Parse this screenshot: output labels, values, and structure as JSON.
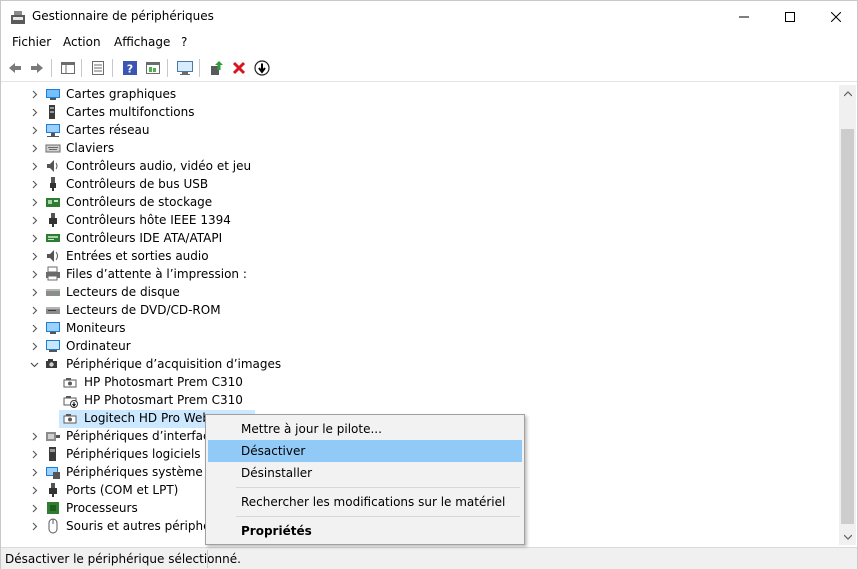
{
  "window": {
    "title": "Gestionnaire de périphériques",
    "minimize_icon": "minimize-icon",
    "maximize_icon": "maximize-icon",
    "close_icon": "close-icon"
  },
  "menu": [
    "Fichier",
    "Action",
    "Affichage",
    "?"
  ],
  "toolbar": [
    "back-arrow-icon",
    "forward-arrow-icon",
    "properties-icon",
    "properties-sheet-icon",
    "help-icon",
    "update-driver-icon",
    "scan-hardware-icon",
    "add-driver-icon",
    "uninstall-icon",
    "disable-icon"
  ],
  "tree": {
    "items": [
      {
        "label": "Cartes graphiques",
        "icon": "display-adapter-icon"
      },
      {
        "label": "Cartes multifonctions",
        "icon": "multifunction-icon"
      },
      {
        "label": "Cartes réseau",
        "icon": "network-adapter-icon"
      },
      {
        "label": "Claviers",
        "icon": "keyboard-icon"
      },
      {
        "label": "Contrôleurs audio, vidéo et jeu",
        "icon": "audio-icon"
      },
      {
        "label": "Contrôleurs de bus USB",
        "icon": "usb-icon"
      },
      {
        "label": "Contrôleurs de stockage",
        "icon": "storage-controller-icon"
      },
      {
        "label": "Contrôleurs hôte IEEE 1394",
        "icon": "ieee1394-icon"
      },
      {
        "label": "Contrôleurs IDE ATA/ATAPI",
        "icon": "ide-icon"
      },
      {
        "label": "Entrées et sorties audio",
        "icon": "audio-io-icon"
      },
      {
        "label": "Files d’attente à l’impression :",
        "icon": "print-queue-icon"
      },
      {
        "label": "Lecteurs de disque",
        "icon": "disk-drive-icon"
      },
      {
        "label": "Lecteurs de DVD/CD-ROM",
        "icon": "dvd-icon"
      },
      {
        "label": "Moniteurs",
        "icon": "monitor-icon"
      },
      {
        "label": "Ordinateur",
        "icon": "computer-icon"
      },
      {
        "label": "Périphérique d’acquisition d’images",
        "icon": "imaging-device-icon",
        "expanded": true
      },
      {
        "label": "HP Photosmart Prem C310",
        "icon": "camera-icon",
        "child": true
      },
      {
        "label": "HP Photosmart Prem C310",
        "icon": "camera-disabled-icon",
        "child": true
      },
      {
        "label": "Logitech HD Pro Webc",
        "icon": "webcam-icon",
        "child": true,
        "selected": true
      },
      {
        "label": "Périphériques d’interface u",
        "icon": "hid-icon"
      },
      {
        "label": "Périphériques logiciels",
        "icon": "software-device-icon"
      },
      {
        "label": "Périphériques système",
        "icon": "system-device-icon"
      },
      {
        "label": "Ports (COM et LPT)",
        "icon": "port-icon"
      },
      {
        "label": "Processeurs",
        "icon": "processor-icon"
      },
      {
        "label": "Souris et autres périphériqu",
        "icon": "mouse-icon"
      }
    ]
  },
  "context_menu": {
    "update": "Mettre à jour le pilote...",
    "disable": "Désactiver",
    "uninstall": "Désinstaller",
    "scan": "Rechercher les modifications sur le matériel",
    "properties": "Propriétés"
  },
  "status": "Désactiver le périphérique sélectionné."
}
